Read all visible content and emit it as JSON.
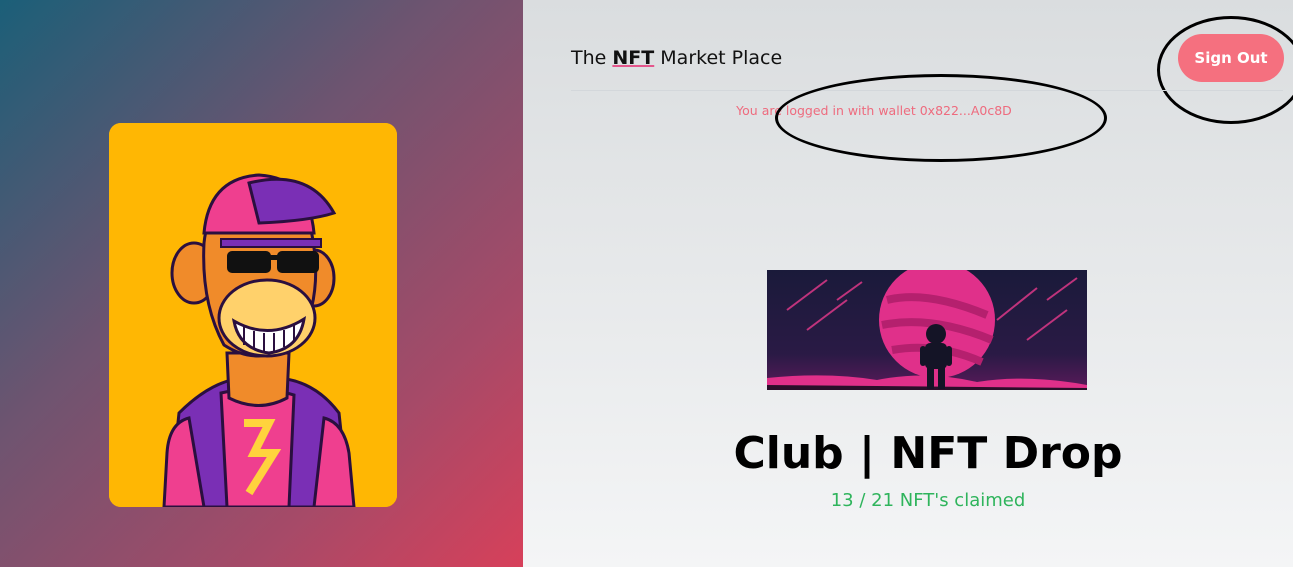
{
  "header": {
    "brand_prefix": "The",
    "brand_highlight": "NFT",
    "brand_suffix": "Market Place",
    "sign_out_label": "Sign Out"
  },
  "wallet": {
    "status_text": "You are logged in with wallet 0x822...A0c8D"
  },
  "drop": {
    "title": "Club | NFT Drop",
    "claimed_text": "13 / 21 NFT's claimed"
  },
  "colors": {
    "accent": "#f5707f",
    "claimed_green": "#2fb45c",
    "card_yellow": "#ffb703"
  }
}
